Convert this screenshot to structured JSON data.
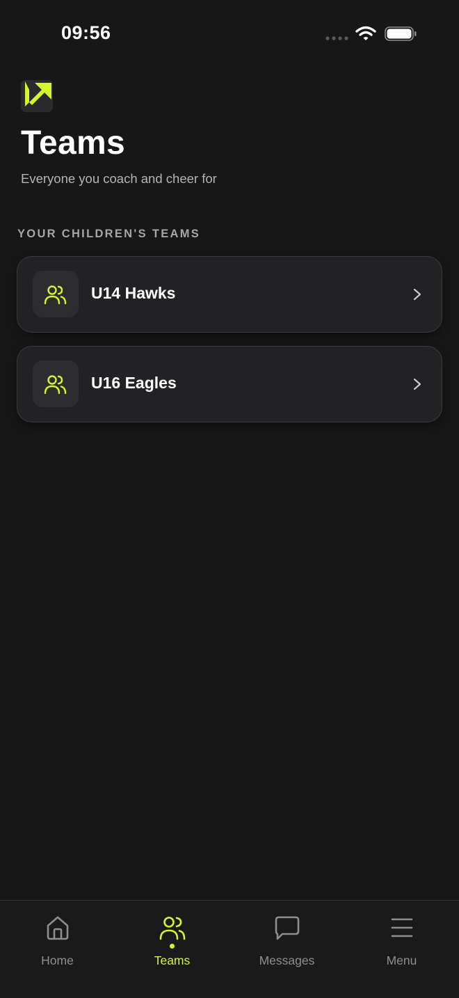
{
  "status_bar": {
    "time": "09:56"
  },
  "header": {
    "logo_icon": "arrow-up-right-logo-icon",
    "title": "Teams",
    "subtitle": "Everyone you coach and cheer for"
  },
  "section": {
    "label": "YOUR CHILDREN'S TEAMS"
  },
  "teams": [
    {
      "name": "U14 Hawks",
      "icon": "users-icon"
    },
    {
      "name": "U16 Eagles",
      "icon": "users-icon"
    }
  ],
  "bottom_nav": {
    "active": "Teams",
    "items": [
      {
        "label": "Home",
        "icon": "home-icon"
      },
      {
        "label": "Teams",
        "icon": "users-icon"
      },
      {
        "label": "Messages",
        "icon": "message-icon"
      },
      {
        "label": "Menu",
        "icon": "menu-icon"
      }
    ]
  },
  "colors": {
    "background": "#181718",
    "card": "#222123",
    "accent": "#d4f72a",
    "muted_text": "#8e8d90"
  }
}
